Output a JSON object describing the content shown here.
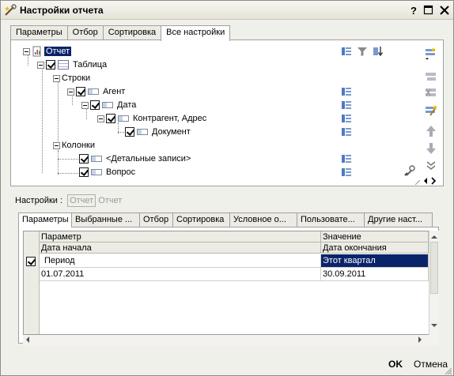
{
  "window": {
    "title": "Настройки отчета",
    "icon": "wrench-wand-icon",
    "buttons": [
      "help-icon",
      "maximize-icon",
      "close-icon"
    ]
  },
  "top_tabs": [
    {
      "label": "Параметры",
      "active": false
    },
    {
      "label": "Отбор",
      "active": false
    },
    {
      "label": "Сортировка",
      "active": false
    },
    {
      "label": "Все настройки",
      "active": true
    }
  ],
  "tree": {
    "root": "Отчет",
    "table": "Таблица",
    "rows": "Строки",
    "agent": "Агент",
    "date": "Дата",
    "counterparty": "Контрагент, Адрес",
    "document": "Документ",
    "columns": "Колонки",
    "details": "<Детальные записи>",
    "question": "Вопрос"
  },
  "settings": {
    "label": "Настройки :",
    "btn": "Отчет",
    "text": "Отчет"
  },
  "bottom_tabs": [
    {
      "label": "Параметры",
      "active": true
    },
    {
      "label": "Выбранные ...",
      "active": false
    },
    {
      "label": "Отбор",
      "active": false
    },
    {
      "label": "Сортировка",
      "active": false
    },
    {
      "label": "Условное о...",
      "active": false
    },
    {
      "label": "Пользовате...",
      "active": false
    },
    {
      "label": "Другие наст...",
      "active": false
    }
  ],
  "grid": {
    "col1_header": "Параметр",
    "col1_sub": "Дата начала",
    "col2_header": "Значение",
    "col2_sub": "Дата окончания",
    "row1_param": "Период",
    "row1_value": "Этот квартал",
    "row2_start": "01.07.2011",
    "row2_end": "30.09.2011"
  },
  "footer": {
    "ok": "OK",
    "cancel": "Отмена"
  },
  "colors": {
    "selection": "#0a246a",
    "window_bg": "#f0f0ea"
  }
}
